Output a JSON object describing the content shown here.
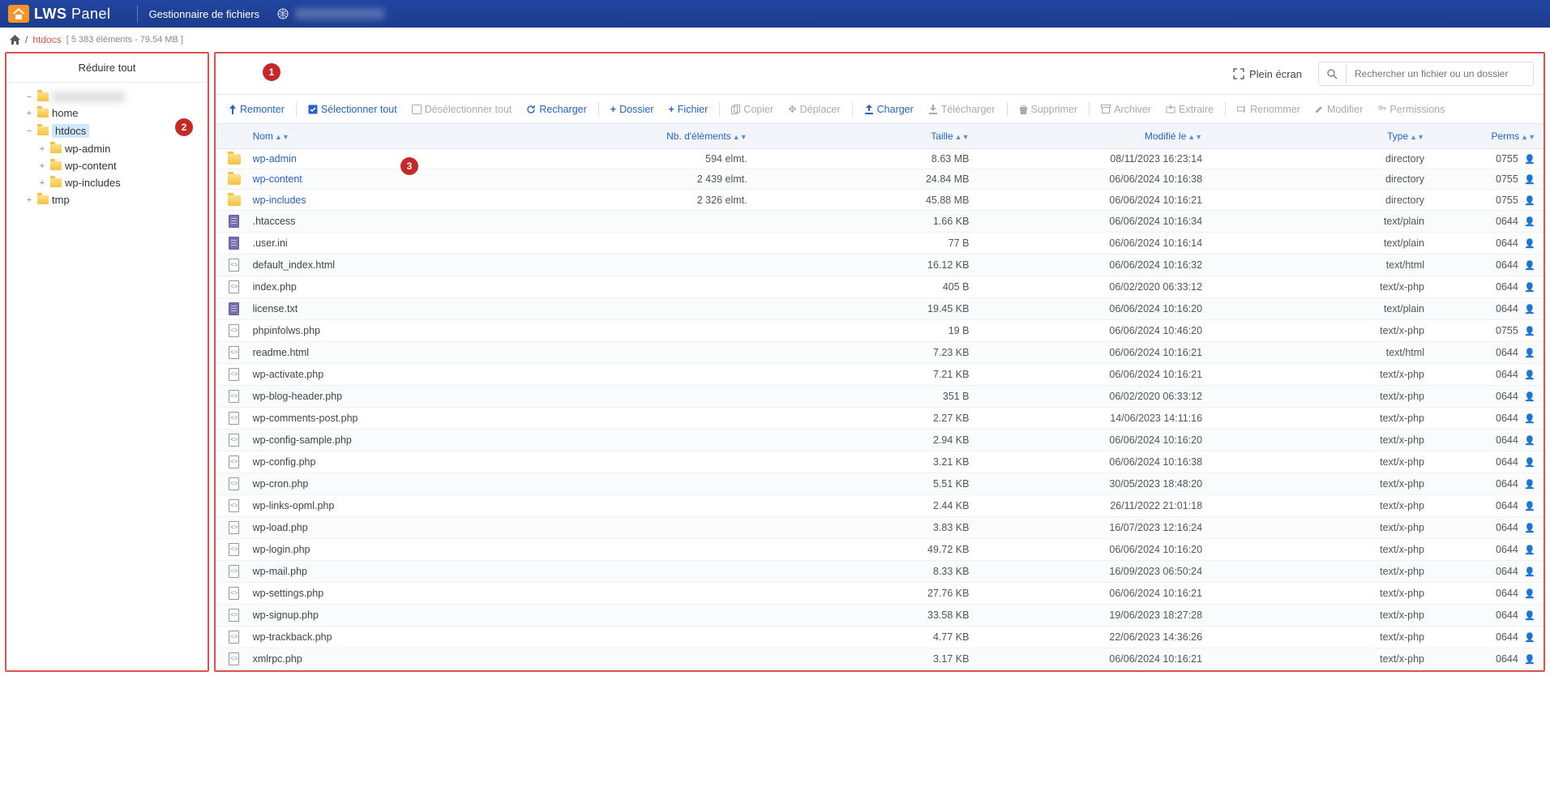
{
  "brand": {
    "name_a": "LWS",
    "name_b": "Panel"
  },
  "header_title": "Gestionnaire de fichiers",
  "breadcrumb": {
    "folder": "htdocs",
    "meta": "[ 5 383 éléments - 79.54 MB ]"
  },
  "fullscreen_label": "Plein écran",
  "search_placeholder": "Rechercher un fichier ou un dossier",
  "sidebar": {
    "collapse_all": "Réduire tout",
    "tree": {
      "home": "home",
      "htdocs": "htdocs",
      "wp_admin": "wp-admin",
      "wp_content": "wp-content",
      "wp_includes": "wp-includes",
      "tmp": "tmp"
    }
  },
  "toolbar": {
    "up": "Remonter",
    "select_all": "Sélectionner tout",
    "deselect_all": "Désélectionner tout",
    "reload": "Recharger",
    "new_folder": "Dossier",
    "new_file": "Fichier",
    "copy": "Copier",
    "move": "Déplacer",
    "upload": "Charger",
    "download": "Télécharger",
    "delete": "Supprimer",
    "archive": "Archiver",
    "extract": "Extraire",
    "rename": "Renommer",
    "edit": "Modifier",
    "perms": "Permissions"
  },
  "columns": {
    "name": "Nom",
    "elements": "Nb. d'éléments",
    "size": "Taille",
    "modified": "Modifié le",
    "type": "Type",
    "perms": "Perms"
  },
  "files": [
    {
      "name": "wp-admin",
      "kind": "dir",
      "elems": "594 elmt.",
      "size": "8.63 MB",
      "mod": "08/11/2023 16:23:14",
      "type": "directory",
      "perm": "0755"
    },
    {
      "name": "wp-content",
      "kind": "dir",
      "elems": "2 439 elmt.",
      "size": "24.84 MB",
      "mod": "06/06/2024 10:16:38",
      "type": "directory",
      "perm": "0755"
    },
    {
      "name": "wp-includes",
      "kind": "dir",
      "elems": "2 326 elmt.",
      "size": "45.88 MB",
      "mod": "06/06/2024 10:16:21",
      "type": "directory",
      "perm": "0755"
    },
    {
      "name": ".htaccess",
      "kind": "txt",
      "elems": "",
      "size": "1.66 KB",
      "mod": "06/06/2024 10:16:34",
      "type": "text/plain",
      "perm": "0644"
    },
    {
      "name": ".user.ini",
      "kind": "txt",
      "elems": "",
      "size": "77 B",
      "mod": "06/06/2024 10:16:14",
      "type": "text/plain",
      "perm": "0644"
    },
    {
      "name": "default_index.html",
      "kind": "php",
      "elems": "",
      "size": "16.12 KB",
      "mod": "06/06/2024 10:16:32",
      "type": "text/html",
      "perm": "0644"
    },
    {
      "name": "index.php",
      "kind": "php",
      "elems": "",
      "size": "405 B",
      "mod": "06/02/2020 06:33:12",
      "type": "text/x-php",
      "perm": "0644"
    },
    {
      "name": "license.txt",
      "kind": "txt",
      "elems": "",
      "size": "19.45 KB",
      "mod": "06/06/2024 10:16:20",
      "type": "text/plain",
      "perm": "0644"
    },
    {
      "name": "phpinfolws.php",
      "kind": "php",
      "elems": "",
      "size": "19 B",
      "mod": "06/06/2024 10:46:20",
      "type": "text/x-php",
      "perm": "0755"
    },
    {
      "name": "readme.html",
      "kind": "php",
      "elems": "",
      "size": "7.23 KB",
      "mod": "06/06/2024 10:16:21",
      "type": "text/html",
      "perm": "0644"
    },
    {
      "name": "wp-activate.php",
      "kind": "php",
      "elems": "",
      "size": "7.21 KB",
      "mod": "06/06/2024 10:16:21",
      "type": "text/x-php",
      "perm": "0644"
    },
    {
      "name": "wp-blog-header.php",
      "kind": "php",
      "elems": "",
      "size": "351 B",
      "mod": "06/02/2020 06:33:12",
      "type": "text/x-php",
      "perm": "0644"
    },
    {
      "name": "wp-comments-post.php",
      "kind": "php",
      "elems": "",
      "size": "2.27 KB",
      "mod": "14/06/2023 14:11:16",
      "type": "text/x-php",
      "perm": "0644"
    },
    {
      "name": "wp-config-sample.php",
      "kind": "php",
      "elems": "",
      "size": "2.94 KB",
      "mod": "06/06/2024 10:16:20",
      "type": "text/x-php",
      "perm": "0644"
    },
    {
      "name": "wp-config.php",
      "kind": "php",
      "elems": "",
      "size": "3.21 KB",
      "mod": "06/06/2024 10:16:38",
      "type": "text/x-php",
      "perm": "0644"
    },
    {
      "name": "wp-cron.php",
      "kind": "php",
      "elems": "",
      "size": "5.51 KB",
      "mod": "30/05/2023 18:48:20",
      "type": "text/x-php",
      "perm": "0644"
    },
    {
      "name": "wp-links-opml.php",
      "kind": "php",
      "elems": "",
      "size": "2.44 KB",
      "mod": "26/11/2022 21:01:18",
      "type": "text/x-php",
      "perm": "0644"
    },
    {
      "name": "wp-load.php",
      "kind": "php",
      "elems": "",
      "size": "3.83 KB",
      "mod": "16/07/2023 12:16:24",
      "type": "text/x-php",
      "perm": "0644"
    },
    {
      "name": "wp-login.php",
      "kind": "php",
      "elems": "",
      "size": "49.72 KB",
      "mod": "06/06/2024 10:16:20",
      "type": "text/x-php",
      "perm": "0644"
    },
    {
      "name": "wp-mail.php",
      "kind": "php",
      "elems": "",
      "size": "8.33 KB",
      "mod": "16/09/2023 06:50:24",
      "type": "text/x-php",
      "perm": "0644"
    },
    {
      "name": "wp-settings.php",
      "kind": "php",
      "elems": "",
      "size": "27.76 KB",
      "mod": "06/06/2024 10:16:21",
      "type": "text/x-php",
      "perm": "0644"
    },
    {
      "name": "wp-signup.php",
      "kind": "php",
      "elems": "",
      "size": "33.58 KB",
      "mod": "19/06/2023 18:27:28",
      "type": "text/x-php",
      "perm": "0644"
    },
    {
      "name": "wp-trackback.php",
      "kind": "php",
      "elems": "",
      "size": "4.77 KB",
      "mod": "22/06/2023 14:36:26",
      "type": "text/x-php",
      "perm": "0644"
    },
    {
      "name": "xmlrpc.php",
      "kind": "php",
      "elems": "",
      "size": "3.17 KB",
      "mod": "06/06/2024 10:16:21",
      "type": "text/x-php",
      "perm": "0644"
    }
  ],
  "badges": {
    "b1": "1",
    "b2": "2",
    "b3": "3"
  }
}
